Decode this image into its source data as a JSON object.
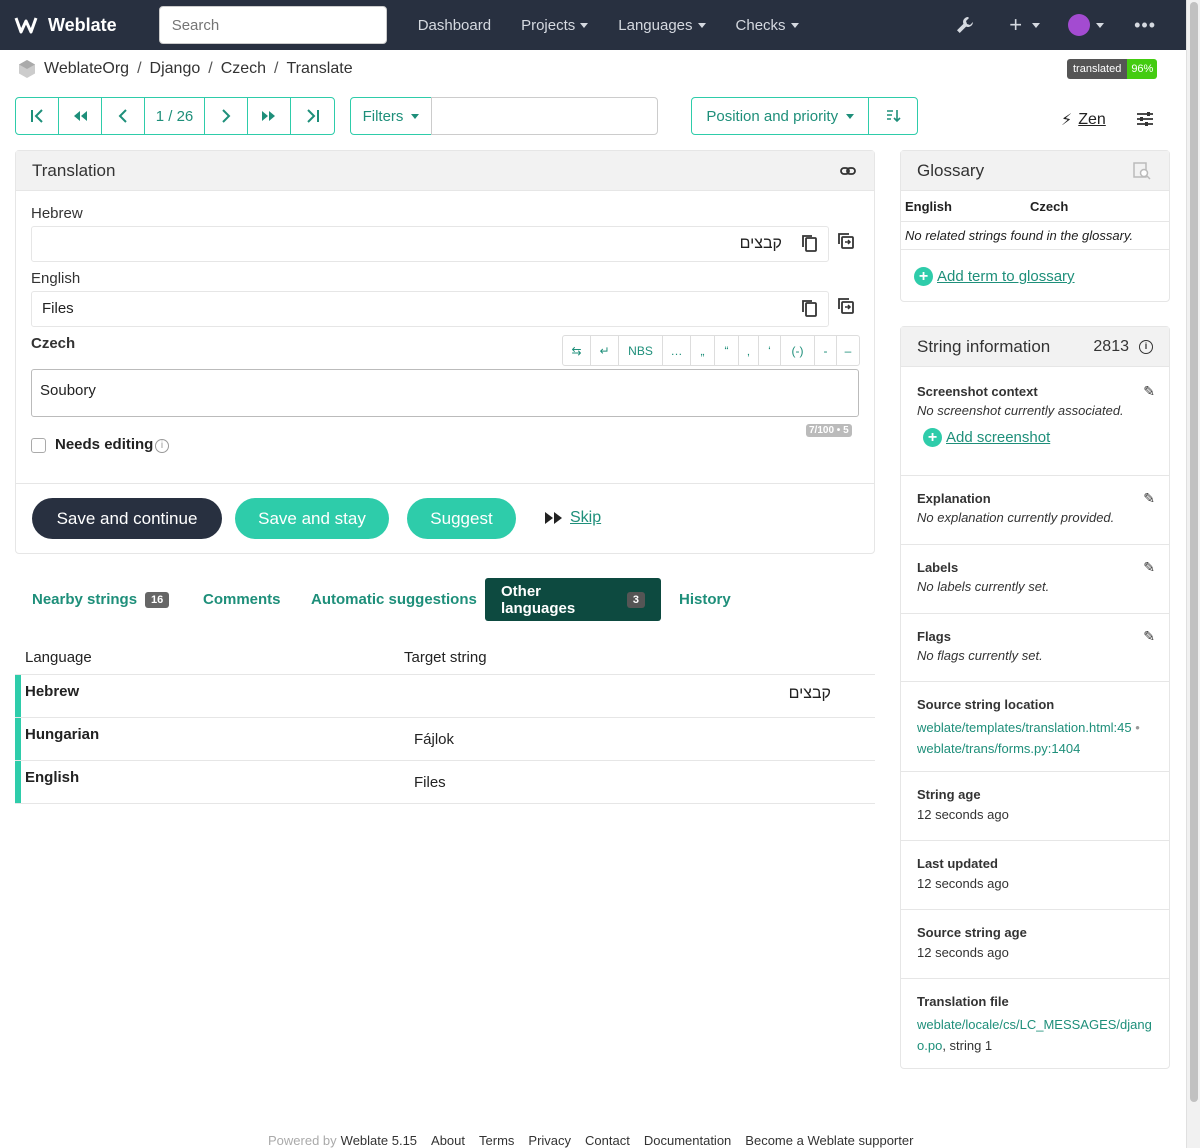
{
  "nav": {
    "brand": "Weblate",
    "search_placeholder": "Search",
    "items": [
      "Dashboard",
      "Projects",
      "Languages",
      "Checks"
    ]
  },
  "breadcrumb": [
    "WeblateOrg",
    "Django",
    "Czech",
    "Translate"
  ],
  "badge": {
    "label": "translated",
    "value": "96%"
  },
  "pager": {
    "position": "1 / 26"
  },
  "filters": {
    "label": "Filters",
    "query": ""
  },
  "sort": {
    "label": "Position and priority"
  },
  "zen": {
    "label": "Zen"
  },
  "translation": {
    "title": "Translation",
    "hebrew_label": "Hebrew",
    "hebrew_value": "קבצים",
    "english_label": "English",
    "english_value": "Files",
    "czech_label": "Czech",
    "czech_value": "Soubory",
    "toolbar": [
      "⇆",
      "↵",
      "NBS",
      "…",
      "„",
      "“",
      "‚",
      "‘",
      "(-)",
      "-",
      "–"
    ],
    "counter": "7/100 • 5",
    "needs_editing": "Needs editing",
    "needs_editing_checked": false,
    "save_continue": "Save and continue",
    "save_stay": "Save and stay",
    "suggest": "Suggest",
    "skip": "Skip"
  },
  "tabs": [
    {
      "label": "Nearby strings",
      "count": "16"
    },
    {
      "label": "Comments",
      "count": ""
    },
    {
      "label": "Automatic suggestions",
      "count": ""
    },
    {
      "label": "Other languages",
      "count": "3",
      "active": true
    },
    {
      "label": "History",
      "count": ""
    }
  ],
  "other_languages": {
    "headers": [
      "Language",
      "Target string"
    ],
    "rows": [
      {
        "language": "Hebrew",
        "target": "קבצים"
      },
      {
        "language": "Hungarian",
        "target": "Fájlok"
      },
      {
        "language": "English",
        "target": "Files"
      }
    ]
  },
  "glossary": {
    "title": "Glossary",
    "col_source": "English",
    "col_target": "Czech",
    "empty": "No related strings found in the glossary.",
    "add": "Add term to glossary"
  },
  "string_info": {
    "title": "String information",
    "id": "2813",
    "screenshot_title": "Screenshot context",
    "screenshot_text": "No screenshot currently associated.",
    "add_screenshot": "Add screenshot",
    "explanation_title": "Explanation",
    "explanation_text": "No explanation currently provided.",
    "labels_title": "Labels",
    "labels_text": "No labels currently set.",
    "flags_title": "Flags",
    "flags_text": "No flags currently set.",
    "location_title": "Source string location",
    "location_1": "weblate/templates/translation.html:45",
    "location_sep": "•",
    "location_2": "weblate/trans/forms.py:1404",
    "string_age_title": "String age",
    "string_age": "12 seconds ago",
    "last_updated_title": "Last updated",
    "last_updated": "12 seconds ago",
    "source_age_title": "Source string age",
    "source_age": "12 seconds ago",
    "file_title": "Translation file",
    "file_link_1": "weblate/locale/cs/LC_MESSAGES/djang",
    "file_link_2": "o.po",
    "file_suffix": ", string 1"
  },
  "footer": {
    "powered": "Powered by",
    "version": "Weblate 5.15",
    "links": [
      "About",
      "Terms",
      "Privacy",
      "Contact",
      "Documentation",
      "Become a Weblate supporter"
    ]
  },
  "colors": {
    "navbar": "#283040",
    "accent": "#2eccaa",
    "link": "#1e8f7a",
    "primary": "#283040"
  }
}
